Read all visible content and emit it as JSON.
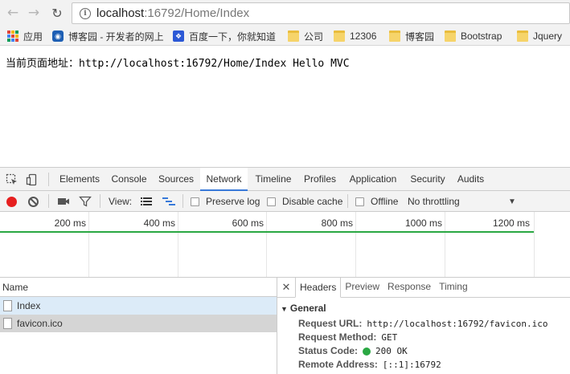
{
  "browser": {
    "url_host": "localhost",
    "url_path": ":16792/Home/Index"
  },
  "bookmarks": [
    {
      "label": "应用",
      "icon": "apps-icon"
    },
    {
      "label": "博客园 - 开发者的网上",
      "icon": "cnblogs-icon"
    },
    {
      "label": "百度一下，你就知道",
      "icon": "baidu-icon"
    },
    {
      "label": "公司",
      "icon": "folder-icon"
    },
    {
      "label": "12306",
      "icon": "folder-icon"
    },
    {
      "label": "博客园",
      "icon": "folder-icon"
    },
    {
      "label": "Bootstrap",
      "icon": "folder-icon"
    },
    {
      "label": "Jquery",
      "icon": "folder-icon"
    }
  ],
  "page": {
    "text": "当前页面地址：http://localhost:16792/Home/Index Hello MVC"
  },
  "devtools": {
    "tabs": [
      "Elements",
      "Console",
      "Sources",
      "Network",
      "Timeline",
      "Profiles",
      "Application",
      "Security",
      "Audits"
    ],
    "active_tab": "Network",
    "controls": {
      "view_label": "View:",
      "preserve_log": "Preserve log",
      "disable_cache": "Disable cache",
      "offline": "Offline",
      "throttling": "No throttling"
    },
    "timeline_ticks": [
      "200 ms",
      "400 ms",
      "600 ms",
      "800 ms",
      "1000 ms",
      "1200 ms"
    ],
    "name_header": "Name",
    "requests": [
      "Index",
      "favicon.ico"
    ],
    "detail_tabs": [
      "Headers",
      "Preview",
      "Response",
      "Timing"
    ],
    "general": {
      "title": "General",
      "request_url_label": "Request URL:",
      "request_url": "http://localhost:16792/favicon.ico",
      "request_method_label": "Request Method:",
      "request_method": "GET",
      "status_code_label": "Status Code:",
      "status_code": "200 OK",
      "remote_address_label": "Remote Address:",
      "remote_address": "[::1]:16792"
    }
  }
}
